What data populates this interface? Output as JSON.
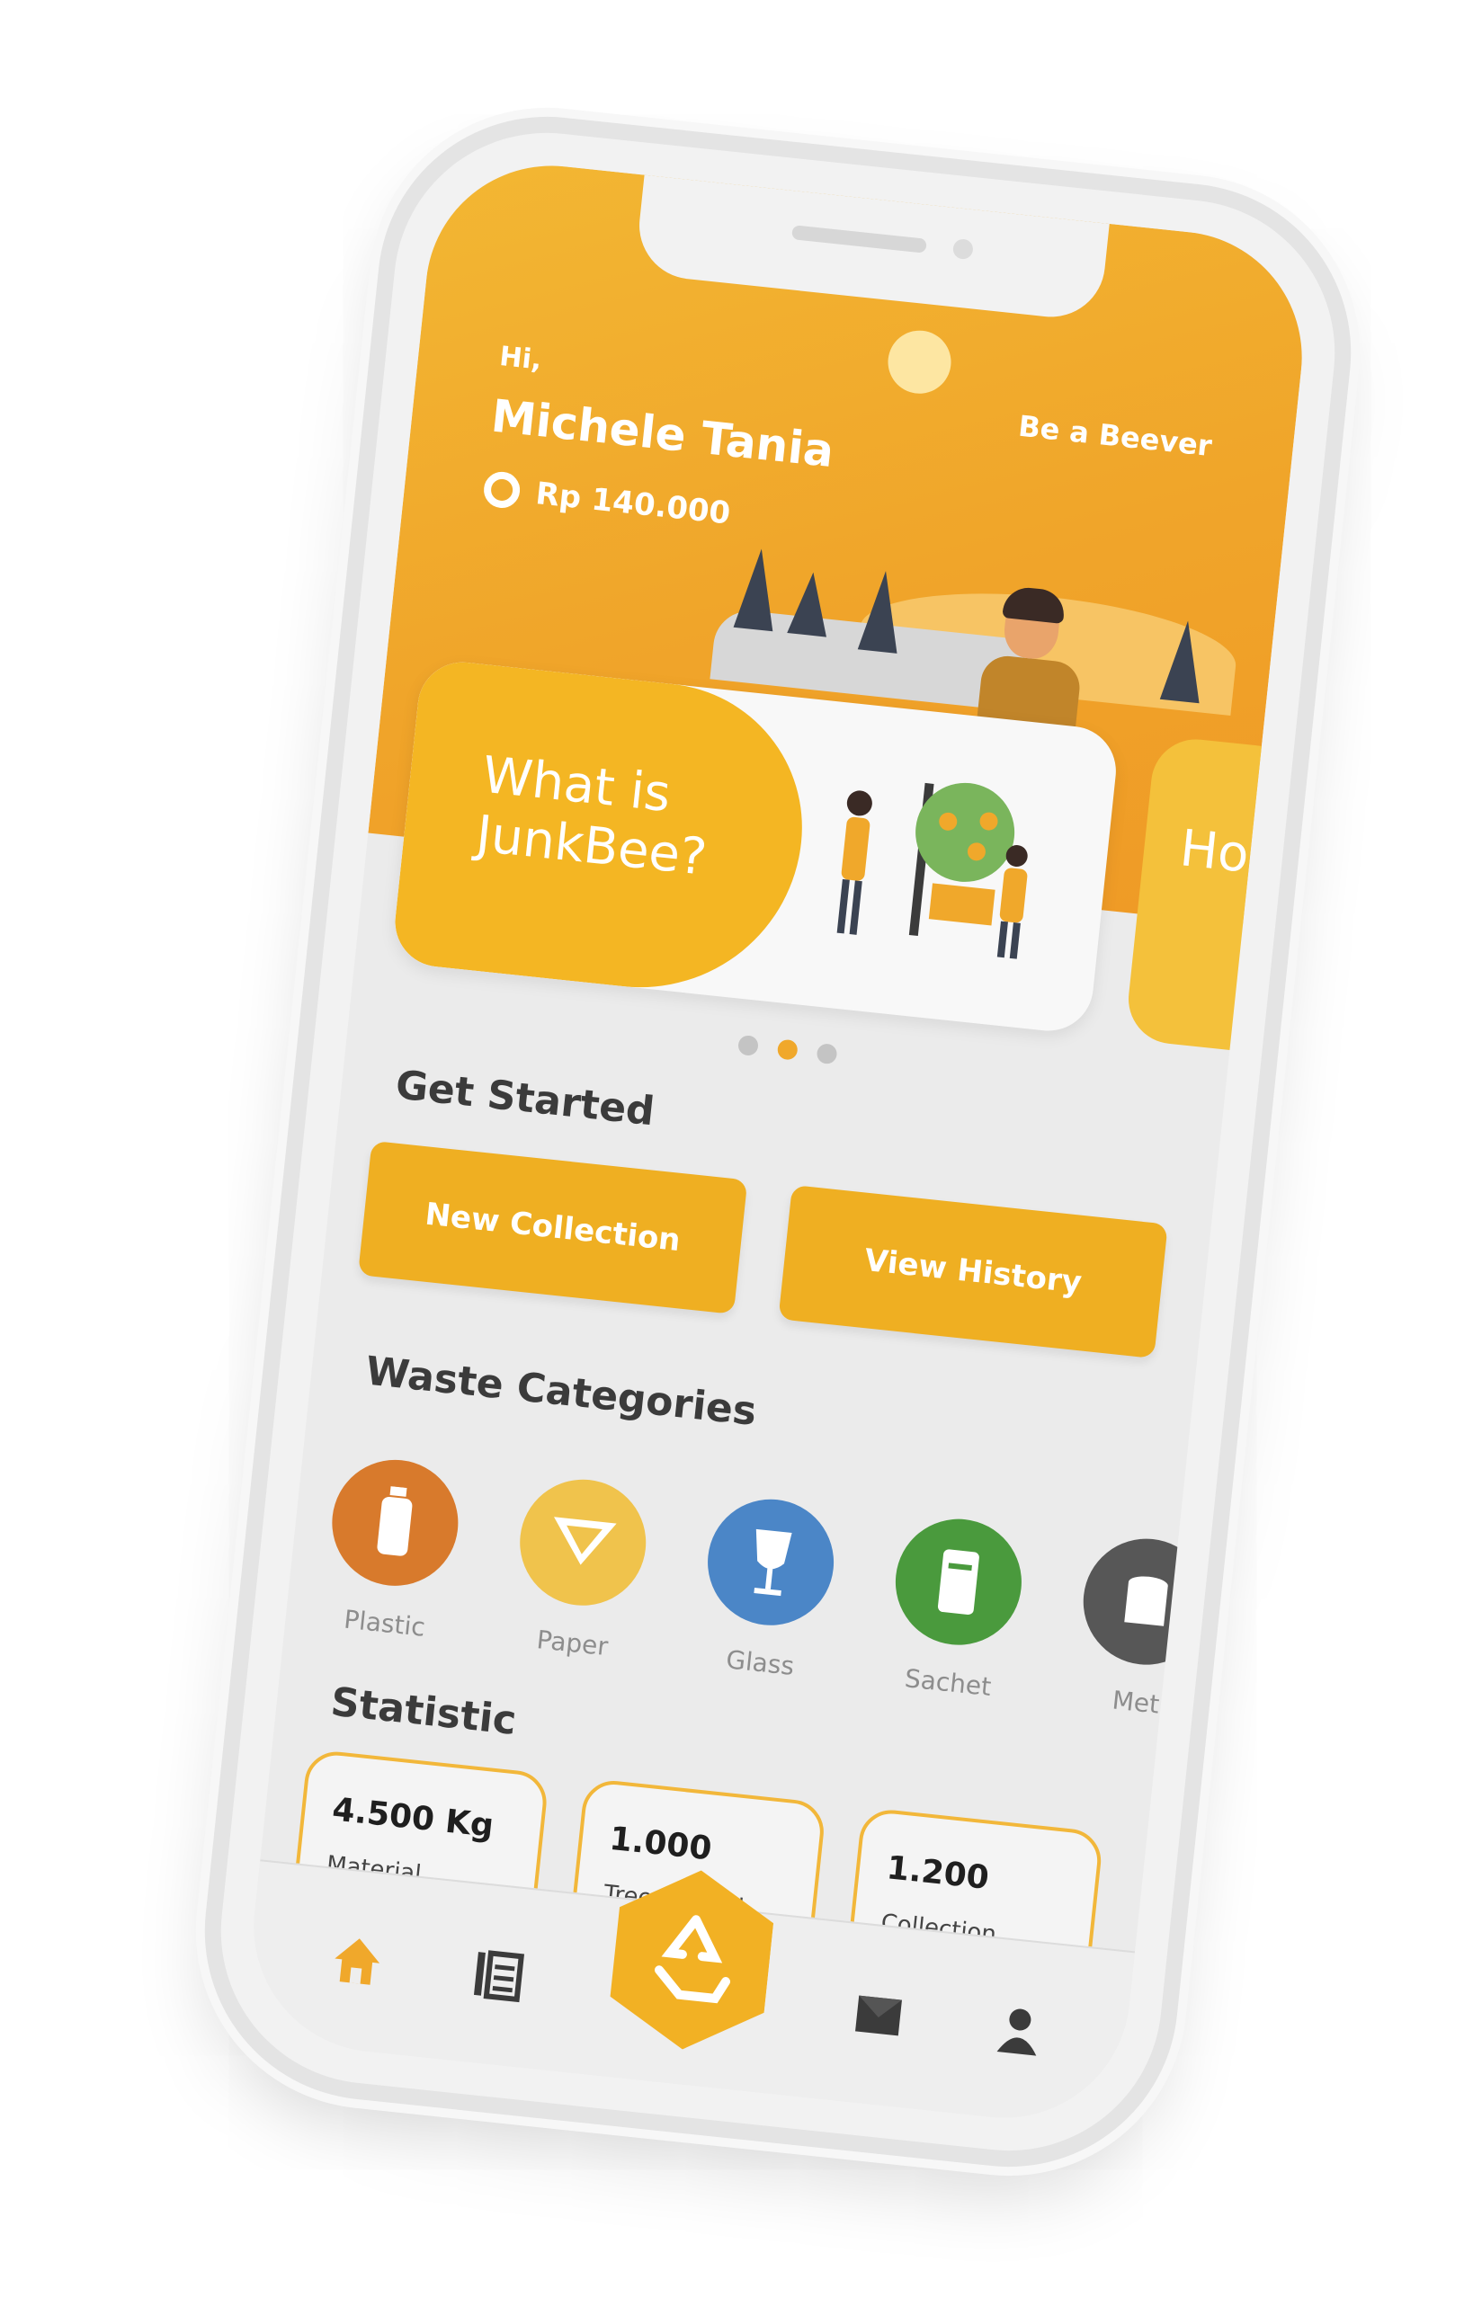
{
  "header": {
    "greeting": "Hi,",
    "user_name": "Michele Tania",
    "balance": "Rp 140.000",
    "beever_link": "Be a Beever"
  },
  "carousel": {
    "cards": [
      {
        "title": "What is JunkBee?"
      },
      {
        "title": "Ho Ju"
      }
    ],
    "active_index": 1,
    "dot_count": 3
  },
  "get_started": {
    "title": "Get Started",
    "new_collection": "New Collection",
    "view_history": "View History"
  },
  "categories": {
    "title": "Waste Categories",
    "items": [
      {
        "label": "Plastic",
        "color": "#d87a2c",
        "icon": "bottle-icon"
      },
      {
        "label": "Paper",
        "color": "#f0c34c",
        "icon": "paper-icon"
      },
      {
        "label": "Glass",
        "color": "#4b86c7",
        "icon": "glass-icon"
      },
      {
        "label": "Sachet",
        "color": "#4a9a3d",
        "icon": "sachet-icon"
      },
      {
        "label": "Met",
        "color": "#575757",
        "icon": "metal-icon"
      }
    ]
  },
  "statistic": {
    "title": "Statistic",
    "items": [
      {
        "value": "4.500 Kg",
        "label": "Material Recycled"
      },
      {
        "value": "1.000",
        "label": "Trees Saved"
      },
      {
        "value": "1.200",
        "label": "Collection Made"
      }
    ]
  },
  "nav": {
    "items": [
      "home-icon",
      "list-icon",
      "recycle-icon",
      "inbox-icon",
      "profile-icon"
    ],
    "active": "home-icon",
    "accent": "#f0a82b"
  }
}
